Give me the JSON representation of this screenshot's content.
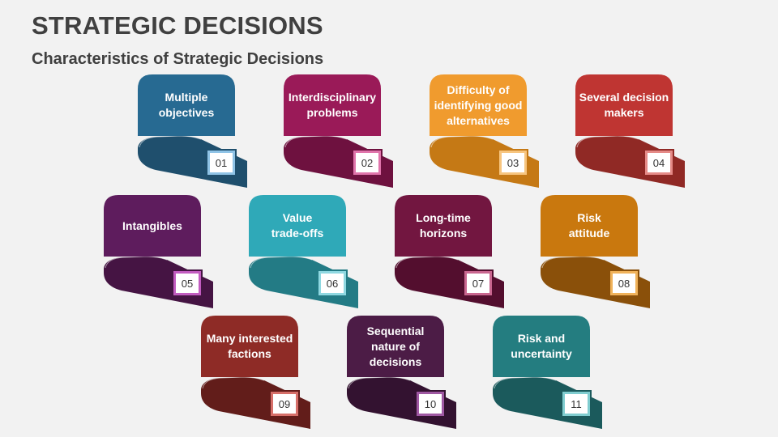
{
  "header": {
    "title": "STRATEGIC DECISIONS",
    "subtitle": "Characteristics of Strategic Decisions"
  },
  "cards": [
    {
      "number": "01",
      "label": "Multiple\nobjectives",
      "color": "#276a92",
      "shade": "#1f4f6d",
      "accent": "#8fc3e6"
    },
    {
      "number": "02",
      "label": "Interdisciplinary\nproblems",
      "color": "#9a1a58",
      "shade": "#6e113f",
      "accent": "#e074ab"
    },
    {
      "number": "03",
      "label": "Difficulty of\nidentifying good\nalternatives",
      "color": "#f09b2e",
      "shade": "#c57915",
      "accent": "#f7c57f"
    },
    {
      "number": "04",
      "label": "Several decision\nmakers",
      "color": "#bf3532",
      "shade": "#902925",
      "accent": "#e58a87"
    },
    {
      "number": "05",
      "label": "Intangibles",
      "color": "#5e1c5d",
      "shade": "#451443",
      "accent": "#c25cc0"
    },
    {
      "number": "06",
      "label": "Value\ntrade-offs",
      "color": "#2fa9b8",
      "shade": "#237b85",
      "accent": "#8fd8e1"
    },
    {
      "number": "07",
      "label": "Long-time\nhorizons",
      "color": "#721640",
      "shade": "#530e2e",
      "accent": "#c9668f"
    },
    {
      "number": "08",
      "label": "Risk\nattitude",
      "color": "#c9780e",
      "shade": "#8a500a",
      "accent": "#f0b25a"
    },
    {
      "number": "09",
      "label": "Many interested\nfactions",
      "color": "#8e2b26",
      "shade": "#621d1a",
      "accent": "#d66f69"
    },
    {
      "number": "10",
      "label": "Sequential\nnature of\ndecisions",
      "color": "#4c1c46",
      "shade": "#331230",
      "accent": "#9f58a2"
    },
    {
      "number": "11",
      "label": "Risk and\nuncertainty",
      "color": "#247d80",
      "shade": "#1b5a5c",
      "accent": "#80cdd0"
    }
  ]
}
